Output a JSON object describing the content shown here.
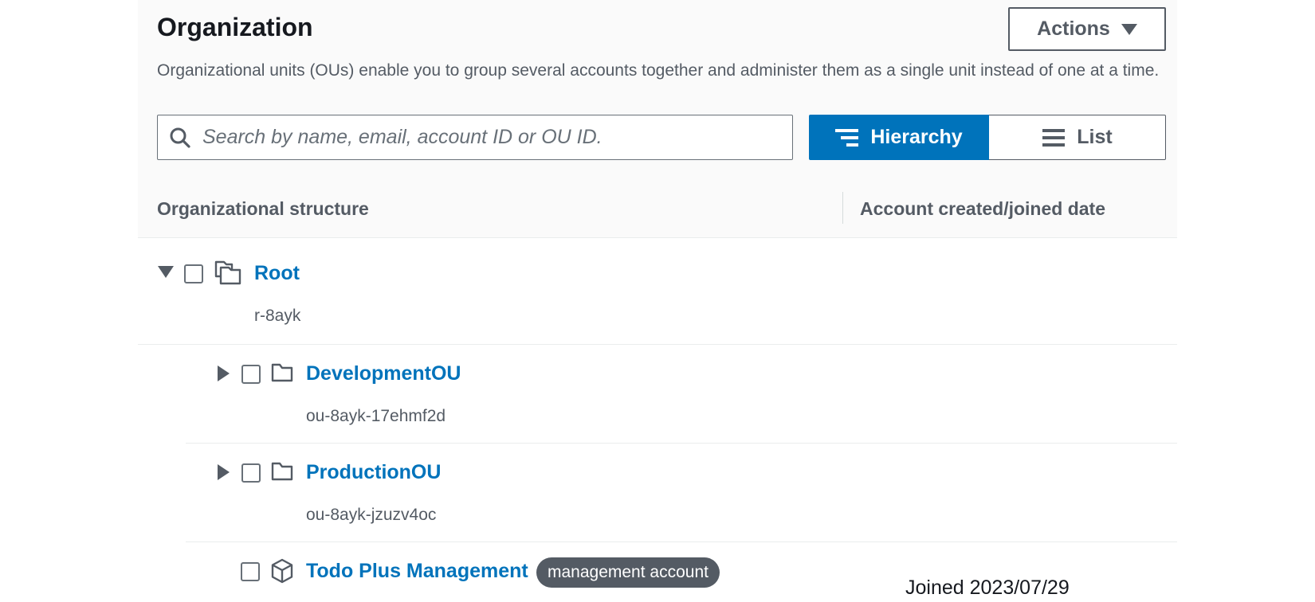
{
  "organization": {
    "title": "Organization",
    "actions_label": "Actions",
    "description": "Organizational units (OUs) enable you to group several accounts together and administer them as a single unit instead of one at a time.",
    "search_placeholder": "Search by name, email, account ID or OU ID.",
    "view_toggle": {
      "hierarchy_label": "Hierarchy",
      "list_label": "List",
      "selected": "Hierarchy"
    }
  },
  "table": {
    "columns": [
      "Organizational structure",
      "Account created/joined date"
    ],
    "rows": [
      {
        "type": "root",
        "name": "Root",
        "id": "r-8ayk",
        "expanded": true,
        "icon": "root-icon"
      },
      {
        "type": "ou",
        "name": "DevelopmentOU",
        "id": "ou-8ayk-17ehmf2d",
        "expanded": false,
        "icon": "folder-icon"
      },
      {
        "type": "ou",
        "name": "ProductionOU",
        "id": "ou-8ayk-jzuzv4oc",
        "expanded": false,
        "icon": "folder-icon"
      },
      {
        "type": "account",
        "name": "Todo Plus Management",
        "badge": "management account",
        "joined": "Joined 2023/07/29",
        "icon": "account-cube-icon"
      }
    ]
  },
  "colors": {
    "accent": "#0073bb",
    "text": "#16191f",
    "muted": "#545b64",
    "badge_bg": "#545b64"
  }
}
